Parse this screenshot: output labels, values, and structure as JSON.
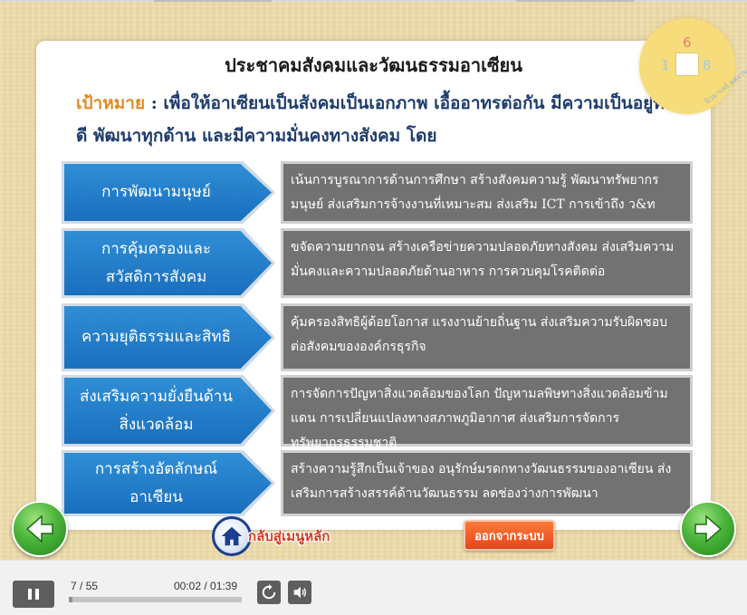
{
  "slide": {
    "title": "ประชาคมสังคมและวัฒนธรรมอาเซียน",
    "goal_label": "เป้าหมาย",
    "goal_sep": " : ",
    "goal_text": "เพื่อให้อาเซียนเป็นสังคมเป็นเอกภาพ เอื้ออาทรต่อกัน มีความเป็นอยู่ที่ดี พัฒนาทุกด้าน และมีความมั่นคงทางสังคม โดย",
    "badge": {
      "num_top": "6",
      "num_left": "1",
      "num_right": "8",
      "curve_text": "นิวมาเลย์ ผลงานครู"
    },
    "rows": [
      {
        "label": "การพัฒนามนุษย์",
        "desc": "เน้นการบูรณาการด้านการศึกษา สร้างสังคมความรู้ พัฒนาทรัพยากรมนุษย์ ส่งเสริมการจ้างงานที่เหมาะสม ส่งเสริม ICT การเข้าถึง ว&ท"
      },
      {
        "label": "การคุ้มครองและสวัสดิการสังคม",
        "desc": "ขจัดความยากจน สร้างเครือข่ายความปลอดภัยทางสังคม ส่งเสริมความมั่นคงและความปลอดภัยด้านอาหาร การควบคุมโรคติดต่อ"
      },
      {
        "label": "ความยุติธรรมและสิทธิ",
        "desc": "คุ้มครองสิทธิผู้ด้อยโอกาส แรงงานย้ายถิ่นฐาน ส่งเสริมความรับผิดชอบต่อสังคมขององค์กรธุรกิจ"
      },
      {
        "label": "ส่งเสริมความยั่งยืนด้านสิ่งแวดล้อม",
        "desc": "การจัดการปัญหาสิ่งแวดล้อมของโลก ปัญหามลพิษทางสิ่งแวดล้อมข้ามแดน การเปลี่ยนแปลงทางสภาพภูมิอากาศ ส่งเสริมการจัดการทรัพยากรธรรมชาติ"
      },
      {
        "label": "การสร้างอัตลักษณ์อาเซียน",
        "desc": "สร้างความรู้สึกเป็นเจ้าของ อนุรักษ์มรดกทางวัฒนธรรมของอาเซียน ส่งเสริมการสร้างสรรค์ด้านวัฒนธรรม ลดช่องว่างการพัฒนา"
      }
    ],
    "home_label": "กลับสู่เมนูหลัก",
    "exit_label": "ออกจากระบบ"
  },
  "player": {
    "slide_current": "7",
    "slide_sep": " / ",
    "slide_total": "55",
    "time_current": "00:02",
    "time_sep": " / ",
    "time_total": "01:39",
    "progress_fraction": 0.02
  },
  "colors": {
    "arrow_blue": "#1a6fbd",
    "desc_gray": "#727272",
    "goal_orange": "#e58a1f",
    "goal_navy": "#1f3c6e",
    "nav_green": "#4bb53a",
    "exit_orange": "#e2461a"
  },
  "icons": {
    "prev": "arrow-left-icon",
    "next": "arrow-right-icon",
    "home": "home-icon",
    "pause": "pause-icon",
    "replay": "replay-icon",
    "volume": "volume-icon"
  }
}
